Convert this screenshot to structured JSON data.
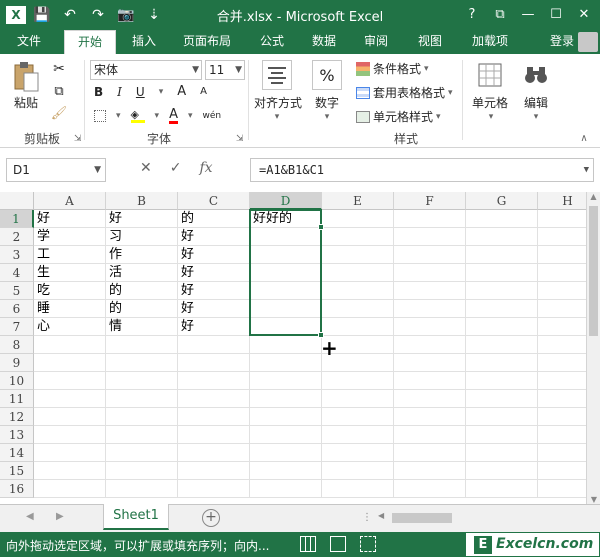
{
  "window": {
    "title": "合并.xlsx - Microsoft Excel",
    "help": "?",
    "restore": "⧉",
    "minimize": "—",
    "maximize": "☐",
    "close": "✕"
  },
  "qat": {
    "save": "💾",
    "undo": "↶",
    "redo": "↷",
    "camera": "📷",
    "more": "⇣"
  },
  "tabs": {
    "file": "文件",
    "items": [
      "开始",
      "插入",
      "页面布局",
      "公式",
      "数据",
      "审阅",
      "视图",
      "加载项"
    ],
    "login": "登录"
  },
  "ribbon": {
    "clipboard": {
      "paste": "粘贴",
      "group": "剪贴板"
    },
    "font": {
      "name": "宋体",
      "size": "11",
      "bold": "B",
      "italic": "I",
      "underline": "U",
      "grow": "A",
      "shrink": "A",
      "wen": "wén",
      "group": "字体"
    },
    "alignment": {
      "label": "对齐方式"
    },
    "number": {
      "label": "数字",
      "symbol": "%"
    },
    "styles": {
      "conditional": "条件格式",
      "table": "套用表格格式",
      "cell": "单元格样式",
      "group": "样式"
    },
    "cells": {
      "label": "单元格"
    },
    "editing": {
      "label": "编辑"
    }
  },
  "formula_bar": {
    "name_box": "D1",
    "cancel": "✕",
    "enter": "✓",
    "fx": "fx",
    "formula": "=A1&B1&C1"
  },
  "sheet": {
    "columns": [
      "A",
      "B",
      "C",
      "D",
      "E",
      "F",
      "G",
      "H"
    ],
    "rows": [
      "1",
      "2",
      "3",
      "4",
      "5",
      "6",
      "7",
      "8",
      "9",
      "10",
      "11",
      "12",
      "13",
      "14",
      "15",
      "16"
    ],
    "cells": [
      [
        "好",
        "好",
        "的",
        "好好的"
      ],
      [
        "学",
        "习",
        "好",
        ""
      ],
      [
        "工",
        "作",
        "好",
        ""
      ],
      [
        "生",
        "活",
        "好",
        ""
      ],
      [
        "吃",
        "的",
        "好",
        ""
      ],
      [
        "睡",
        "的",
        "好",
        ""
      ],
      [
        "心",
        "情",
        "好",
        ""
      ]
    ]
  },
  "sheet_tabs": {
    "active": "Sheet1",
    "add": "+"
  },
  "status": {
    "message": "向外拖动选定区域，可以扩展或填充序列；向内..."
  },
  "watermark": {
    "icon": "E",
    "text": "Excelcn.com"
  }
}
